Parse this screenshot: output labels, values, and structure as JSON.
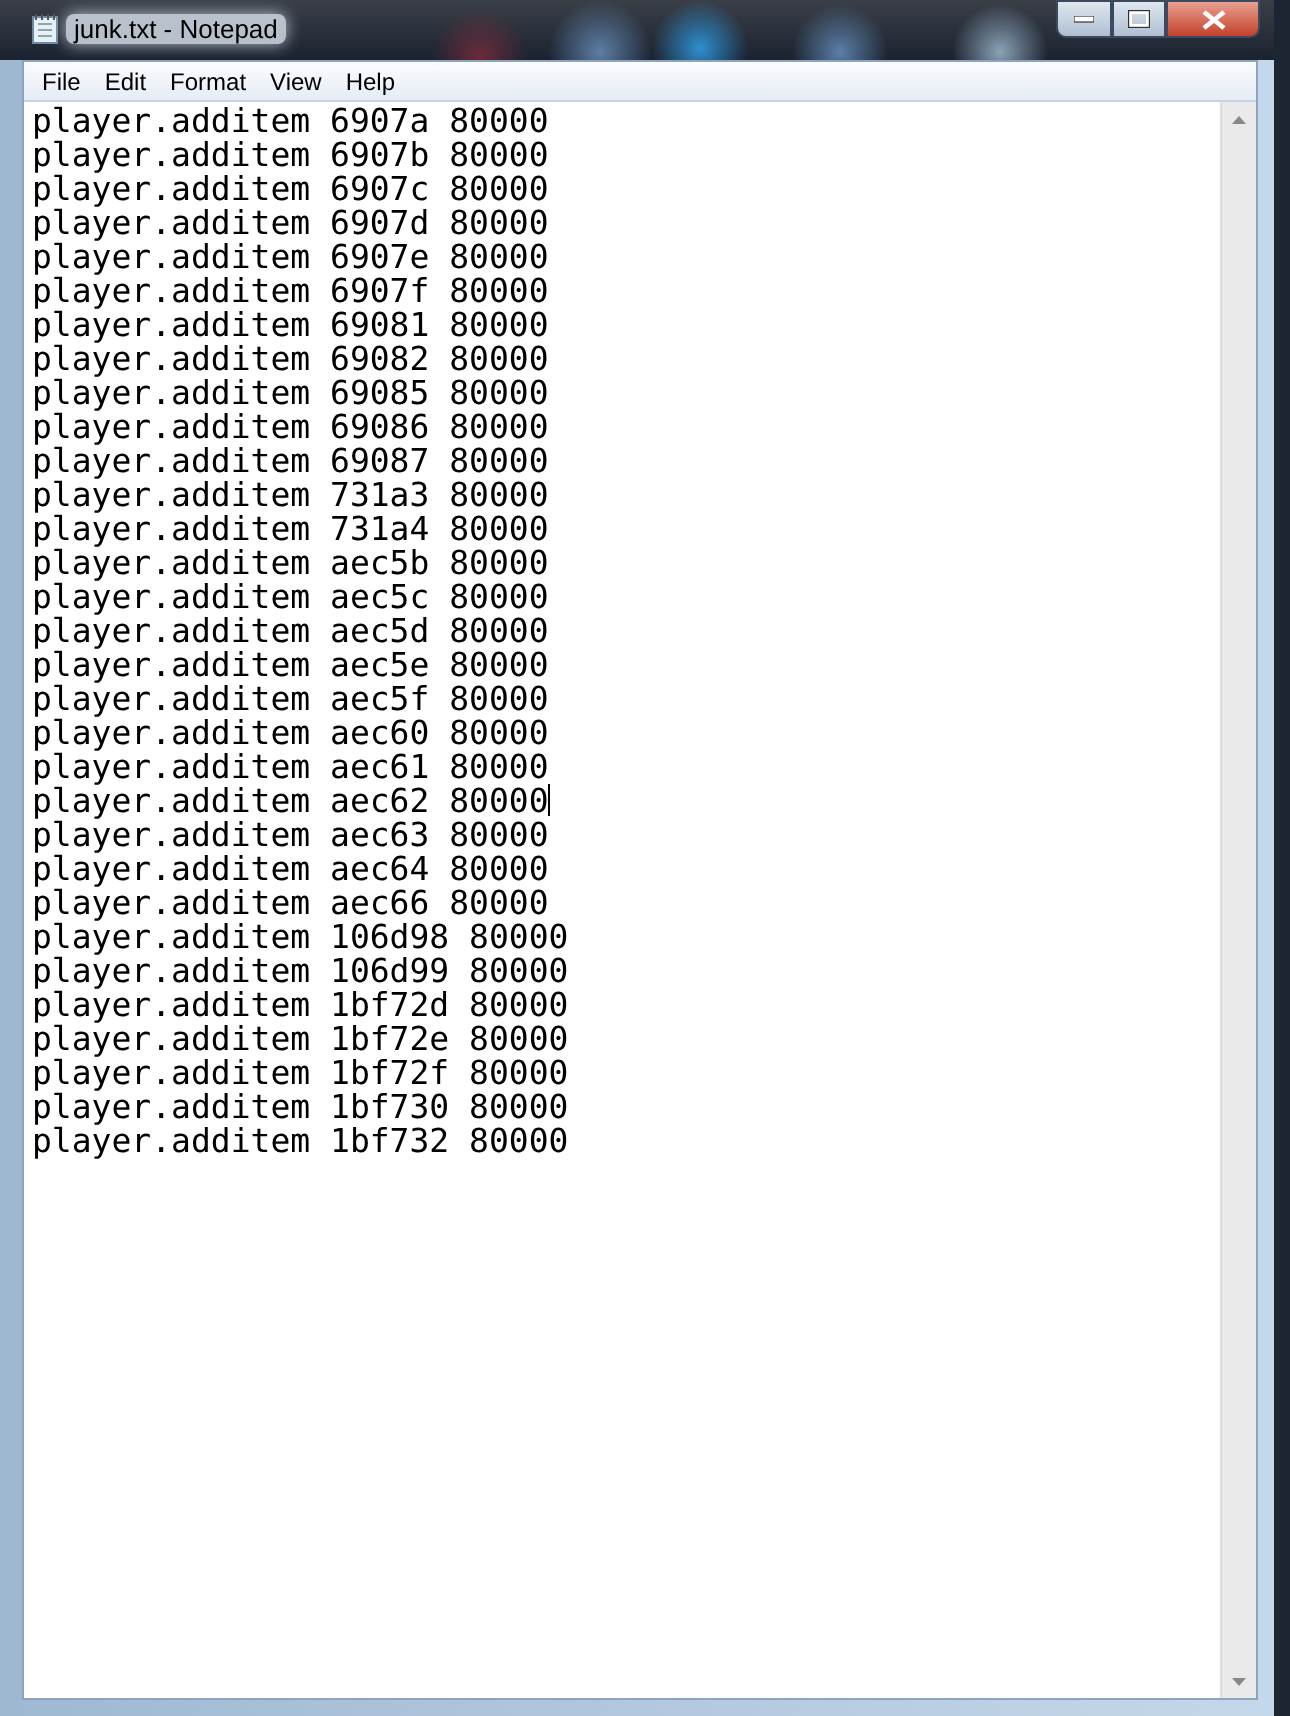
{
  "window": {
    "title": "junk.txt - Notepad"
  },
  "menu": [
    "File",
    "Edit",
    "Format",
    "View",
    "Help"
  ],
  "lines": [
    {
      "text": "player.additem 6907a 80000",
      "caret": false
    },
    {
      "text": "player.additem 6907b 80000",
      "caret": false
    },
    {
      "text": "player.additem 6907c 80000",
      "caret": false
    },
    {
      "text": "player.additem 6907d 80000",
      "caret": false
    },
    {
      "text": "player.additem 6907e 80000",
      "caret": false
    },
    {
      "text": "player.additem 6907f 80000",
      "caret": false
    },
    {
      "text": "player.additem 69081 80000",
      "caret": false
    },
    {
      "text": "player.additem 69082 80000",
      "caret": false
    },
    {
      "text": "player.additem 69085 80000",
      "caret": false
    },
    {
      "text": "player.additem 69086 80000",
      "caret": false
    },
    {
      "text": "player.additem 69087 80000",
      "caret": false
    },
    {
      "text": "player.additem 731a3 80000",
      "caret": false
    },
    {
      "text": "player.additem 731a4 80000",
      "caret": false
    },
    {
      "text": "player.additem aec5b 80000",
      "caret": false
    },
    {
      "text": "player.additem aec5c 80000",
      "caret": false
    },
    {
      "text": "player.additem aec5d 80000",
      "caret": false
    },
    {
      "text": "player.additem aec5e 80000",
      "caret": false
    },
    {
      "text": "player.additem aec5f 80000",
      "caret": false
    },
    {
      "text": "player.additem aec60 80000",
      "caret": false
    },
    {
      "text": "player.additem aec61 80000",
      "caret": false
    },
    {
      "text": "player.additem aec62 80000",
      "caret": true
    },
    {
      "text": "player.additem aec63 80000",
      "caret": false
    },
    {
      "text": "player.additem aec64 80000",
      "caret": false
    },
    {
      "text": "player.additem aec66 80000",
      "caret": false
    },
    {
      "text": "player.additem 106d98 80000",
      "caret": false
    },
    {
      "text": "player.additem 106d99 80000",
      "caret": false
    },
    {
      "text": "player.additem 1bf72d 80000",
      "caret": false
    },
    {
      "text": "player.additem 1bf72e 80000",
      "caret": false
    },
    {
      "text": "player.additem 1bf72f 80000",
      "caret": false
    },
    {
      "text": "player.additem 1bf730 80000",
      "caret": false
    },
    {
      "text": "player.additem 1bf732 80000",
      "caret": false
    }
  ]
}
